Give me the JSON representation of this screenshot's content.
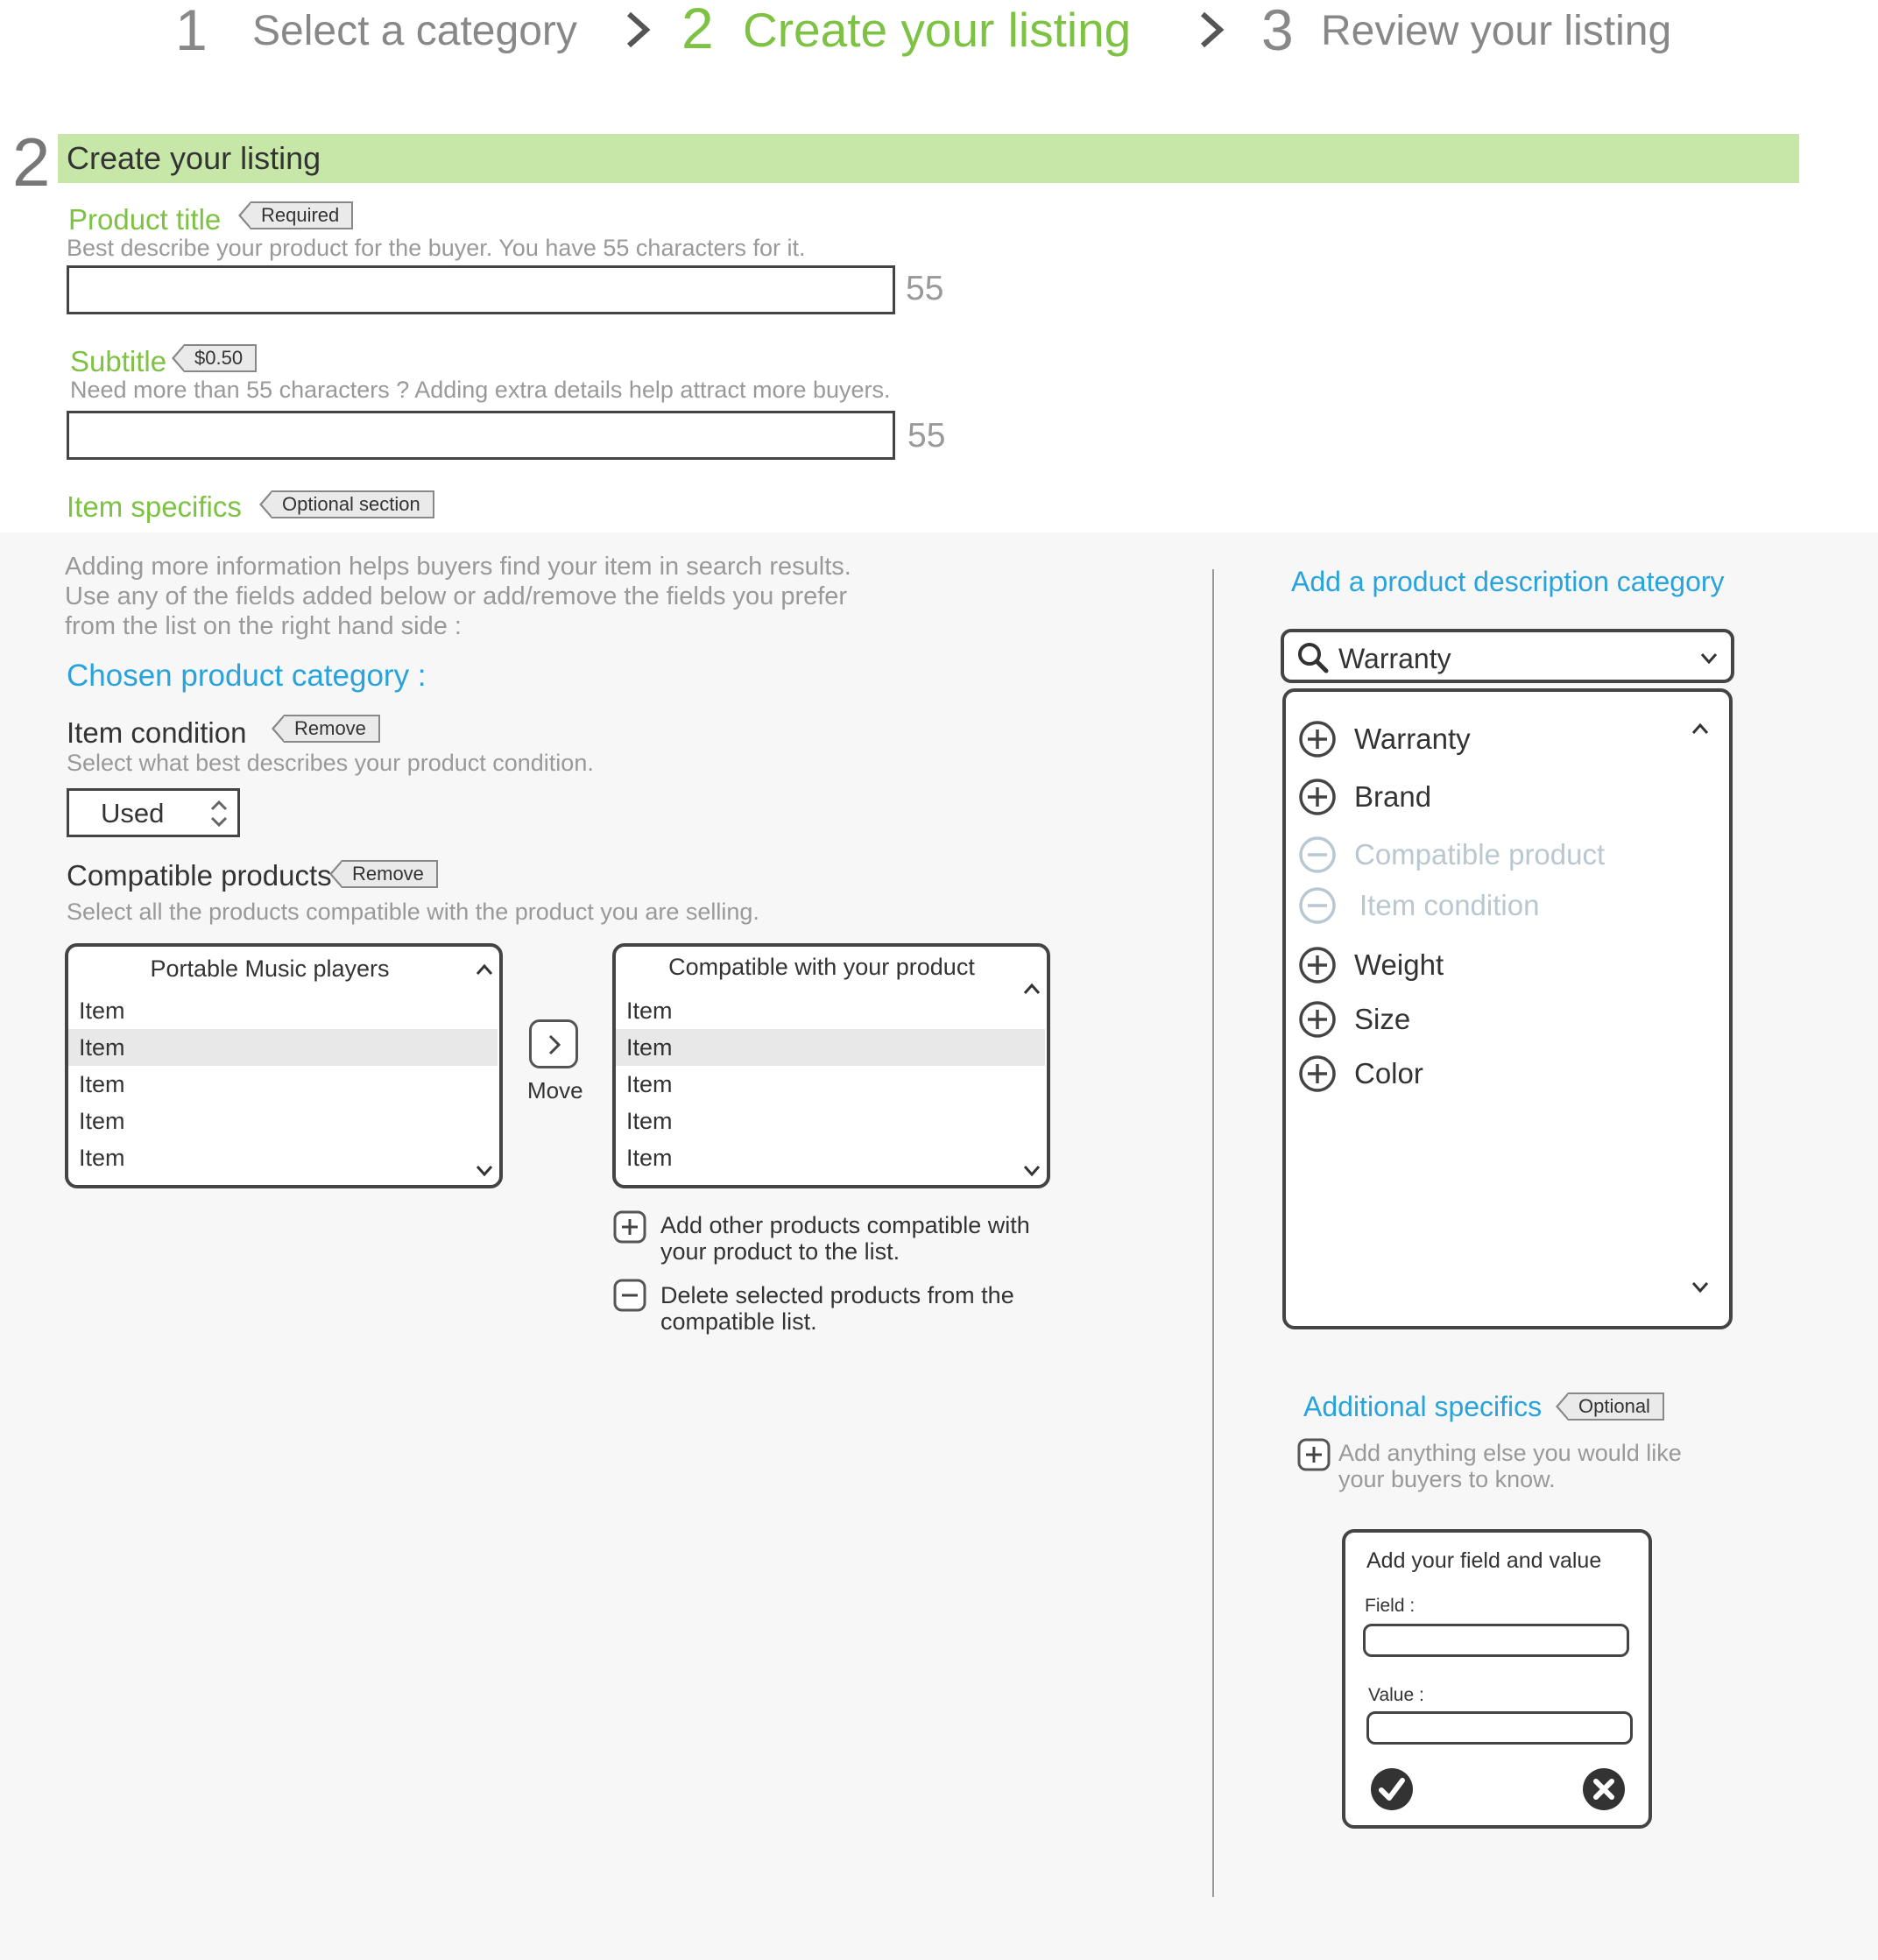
{
  "stepper": {
    "steps": [
      {
        "num": "1",
        "label": "Select a category"
      },
      {
        "num": "2",
        "label": "Create your listing"
      },
      {
        "num": "3",
        "label": "Review your listing"
      }
    ]
  },
  "section": {
    "num": "2",
    "title": "Create your listing"
  },
  "product_title": {
    "label": "Product title",
    "tag": "Required",
    "hint": "Best describe your product for the buyer. You have 55 characters for it.",
    "value": "",
    "counter": "55"
  },
  "subtitle": {
    "label": "Subtitle",
    "tag": "$0.50",
    "hint": "Need more than 55 characters ? Adding extra details help attract more buyers.",
    "value": "",
    "counter": "55"
  },
  "item_specifics": {
    "label": "Item specifics",
    "tag": "Optional section",
    "intro": [
      "Adding more information helps buyers find your item in search results.",
      "Use any of the fields added below or add/remove the fields you prefer",
      "from the list on the right hand side :"
    ],
    "chosen_heading": "Chosen product category :"
  },
  "item_condition": {
    "label": "Item condition",
    "tag": "Remove",
    "hint": "Select what best describes your product condition.",
    "value": "Used"
  },
  "compatible": {
    "label": "Compatible products",
    "tag": "Remove",
    "hint": "Select all the products compatible with the product you are selling.",
    "left_title": "Portable Music players",
    "left_items": [
      "Item",
      "Item",
      "Item",
      "Item",
      "Item"
    ],
    "move_label": "Move",
    "right_title": "Compatible with your product",
    "right_items": [
      "Item",
      "Item",
      "Item",
      "Item",
      "Item"
    ],
    "add_line1": "Add other products compatible with",
    "add_line2": "your product to the list.",
    "delete_line1": "Delete selected products from the",
    "delete_line2": "compatible list."
  },
  "description_category": {
    "heading": "Add a product description category",
    "search_value": "Warranty",
    "options": [
      {
        "label": "Warranty",
        "state": "add"
      },
      {
        "label": "Brand",
        "state": "add"
      },
      {
        "label": "Compatible product",
        "state": "remove"
      },
      {
        "label": "Item condition",
        "state": "remove"
      },
      {
        "label": "Weight",
        "state": "add"
      },
      {
        "label": "Size",
        "state": "add"
      },
      {
        "label": "Color",
        "state": "add"
      }
    ]
  },
  "additional": {
    "label": "Additional specifics",
    "tag": "Optional",
    "hint_line1": "Add anything else you would like",
    "hint_line2": "your buyers to know.",
    "card_title": "Add your field and value",
    "field_label": "Field :",
    "value_label": "Value :"
  },
  "colors": {
    "accent_green": "#7dc242",
    "accent_blue": "#29a3dc",
    "section_bar": "#c6e7a7"
  }
}
